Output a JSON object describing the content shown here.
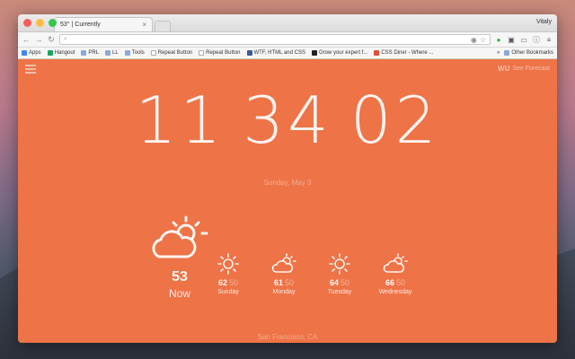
{
  "browser": {
    "tab_title": "53° | Currently",
    "profile": "Vitaly",
    "address": "",
    "bookmarks": [
      {
        "label": "Apps",
        "icon": "apps-icon"
      },
      {
        "label": "Hangout",
        "icon": "hangout-icon"
      },
      {
        "label": "PRL",
        "icon": "folder-icon"
      },
      {
        "label": "LL",
        "icon": "folder-icon"
      },
      {
        "label": "Tools",
        "icon": "folder-icon"
      },
      {
        "label": "Repeat Button",
        "icon": "page-icon"
      },
      {
        "label": "Repeat Button",
        "icon": "page-icon"
      },
      {
        "label": "WTF, HTML and CSS",
        "icon": "wtf-icon"
      },
      {
        "label": "Grow your expert f...",
        "icon": "grow-icon"
      },
      {
        "label": "CSS Diner - Where ...",
        "icon": "css-icon"
      }
    ],
    "other_bookmarks": "Other Bookmarks"
  },
  "app": {
    "brand_mark": "WU",
    "brand_label": "See Forecast",
    "clock": {
      "hours": "11",
      "minutes": "34",
      "seconds": "02"
    },
    "date": "Sunday, May 3",
    "now": {
      "temp": "53",
      "label": "Now",
      "icon": "partly-cloudy-icon"
    },
    "forecast": [
      {
        "hi": "62",
        "lo": "50",
        "day": "Sunday",
        "icon": "sun-icon"
      },
      {
        "hi": "61",
        "lo": "50",
        "day": "Monday",
        "icon": "partly-cloudy-icon"
      },
      {
        "hi": "64",
        "lo": "50",
        "day": "Tuesday",
        "icon": "sun-icon"
      },
      {
        "hi": "66",
        "lo": "50",
        "day": "Wednesday",
        "icon": "partly-cloudy-icon"
      }
    ],
    "location": "San Francisco, CA",
    "accent": "#ee7347"
  }
}
